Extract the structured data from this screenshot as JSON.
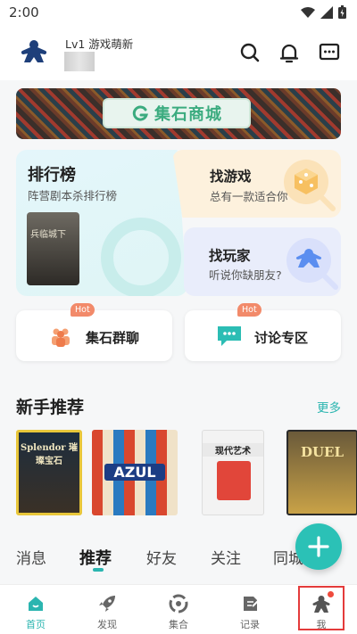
{
  "status_bar": {
    "time": "2:00"
  },
  "header": {
    "level": "Lv1 游戏萌新"
  },
  "banner": {
    "label": "集石商城"
  },
  "cards": {
    "rank": {
      "title": "排行榜",
      "subtitle": "阵营剧本杀排行榜",
      "poster_text": "兵临城下"
    },
    "find_game": {
      "title": "找游戏",
      "subtitle": "总有一款适合你"
    },
    "find_player": {
      "title": "找玩家",
      "subtitle": "听说你缺朋友?"
    }
  },
  "quick_buttons": [
    {
      "label": "集石群聊",
      "badge": "Hot"
    },
    {
      "label": "讨论专区",
      "badge": "Hot"
    }
  ],
  "recommend": {
    "title": "新手推荐",
    "more": "更多",
    "games": [
      {
        "name": "Splendor 璀璨宝石"
      },
      {
        "name": "AZUL"
      },
      {
        "name": "现代艺术"
      },
      {
        "name": "DUEL"
      }
    ]
  },
  "feed_tabs": [
    "消息",
    "推荐",
    "好友",
    "关注",
    "同城"
  ],
  "active_feed_tab": "推荐",
  "bottom_nav": [
    {
      "label": "首页",
      "icon": "home-icon",
      "active": true
    },
    {
      "label": "发现",
      "icon": "rocket-icon",
      "active": false
    },
    {
      "label": "集合",
      "icon": "collection-icon",
      "active": false
    },
    {
      "label": "记录",
      "icon": "record-icon",
      "active": false
    },
    {
      "label": "我",
      "icon": "meeple-icon",
      "active": false
    }
  ],
  "colors": {
    "accent": "#2bb5b0",
    "badge": "#f28a6a",
    "notify_dot": "#ef4b3d"
  }
}
